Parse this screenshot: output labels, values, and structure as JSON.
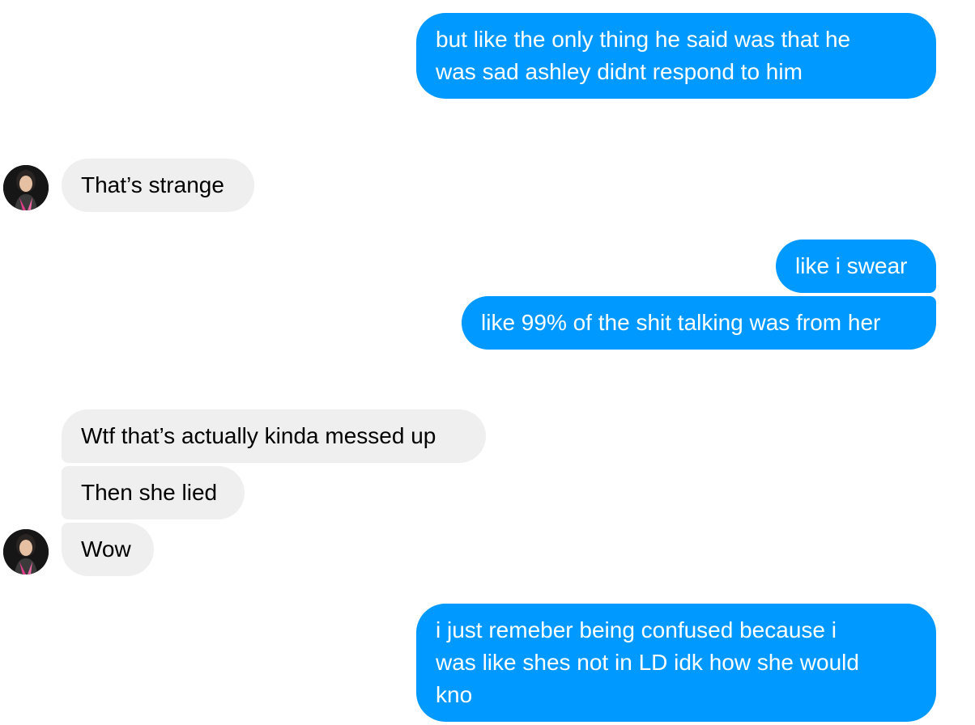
{
  "conversation": {
    "messages": [
      {
        "sender": "me",
        "text": "but like the only thing he said was that he\nwas sad ashley didnt respond to him"
      },
      {
        "sender": "contact",
        "text": "That’s strange"
      },
      {
        "sender": "me",
        "text": "like i swear"
      },
      {
        "sender": "me",
        "text": "like 99% of the shit talking was from her"
      },
      {
        "sender": "contact",
        "text": "Wtf that’s actually kinda messed up"
      },
      {
        "sender": "contact",
        "text": "Then she lied"
      },
      {
        "sender": "contact",
        "text": "Wow"
      },
      {
        "sender": "me",
        "text": "i just remeber being confused because i\nwas like shes not in LD idk how she would\nkno"
      }
    ]
  },
  "theme": {
    "outgoing_bubble_color": "#0099ff",
    "incoming_bubble_color": "#f0eff0",
    "outgoing_text_color": "#ffffff",
    "incoming_text_color": "#000000"
  },
  "icons": {
    "contact_avatar": "contact-avatar-photo"
  }
}
